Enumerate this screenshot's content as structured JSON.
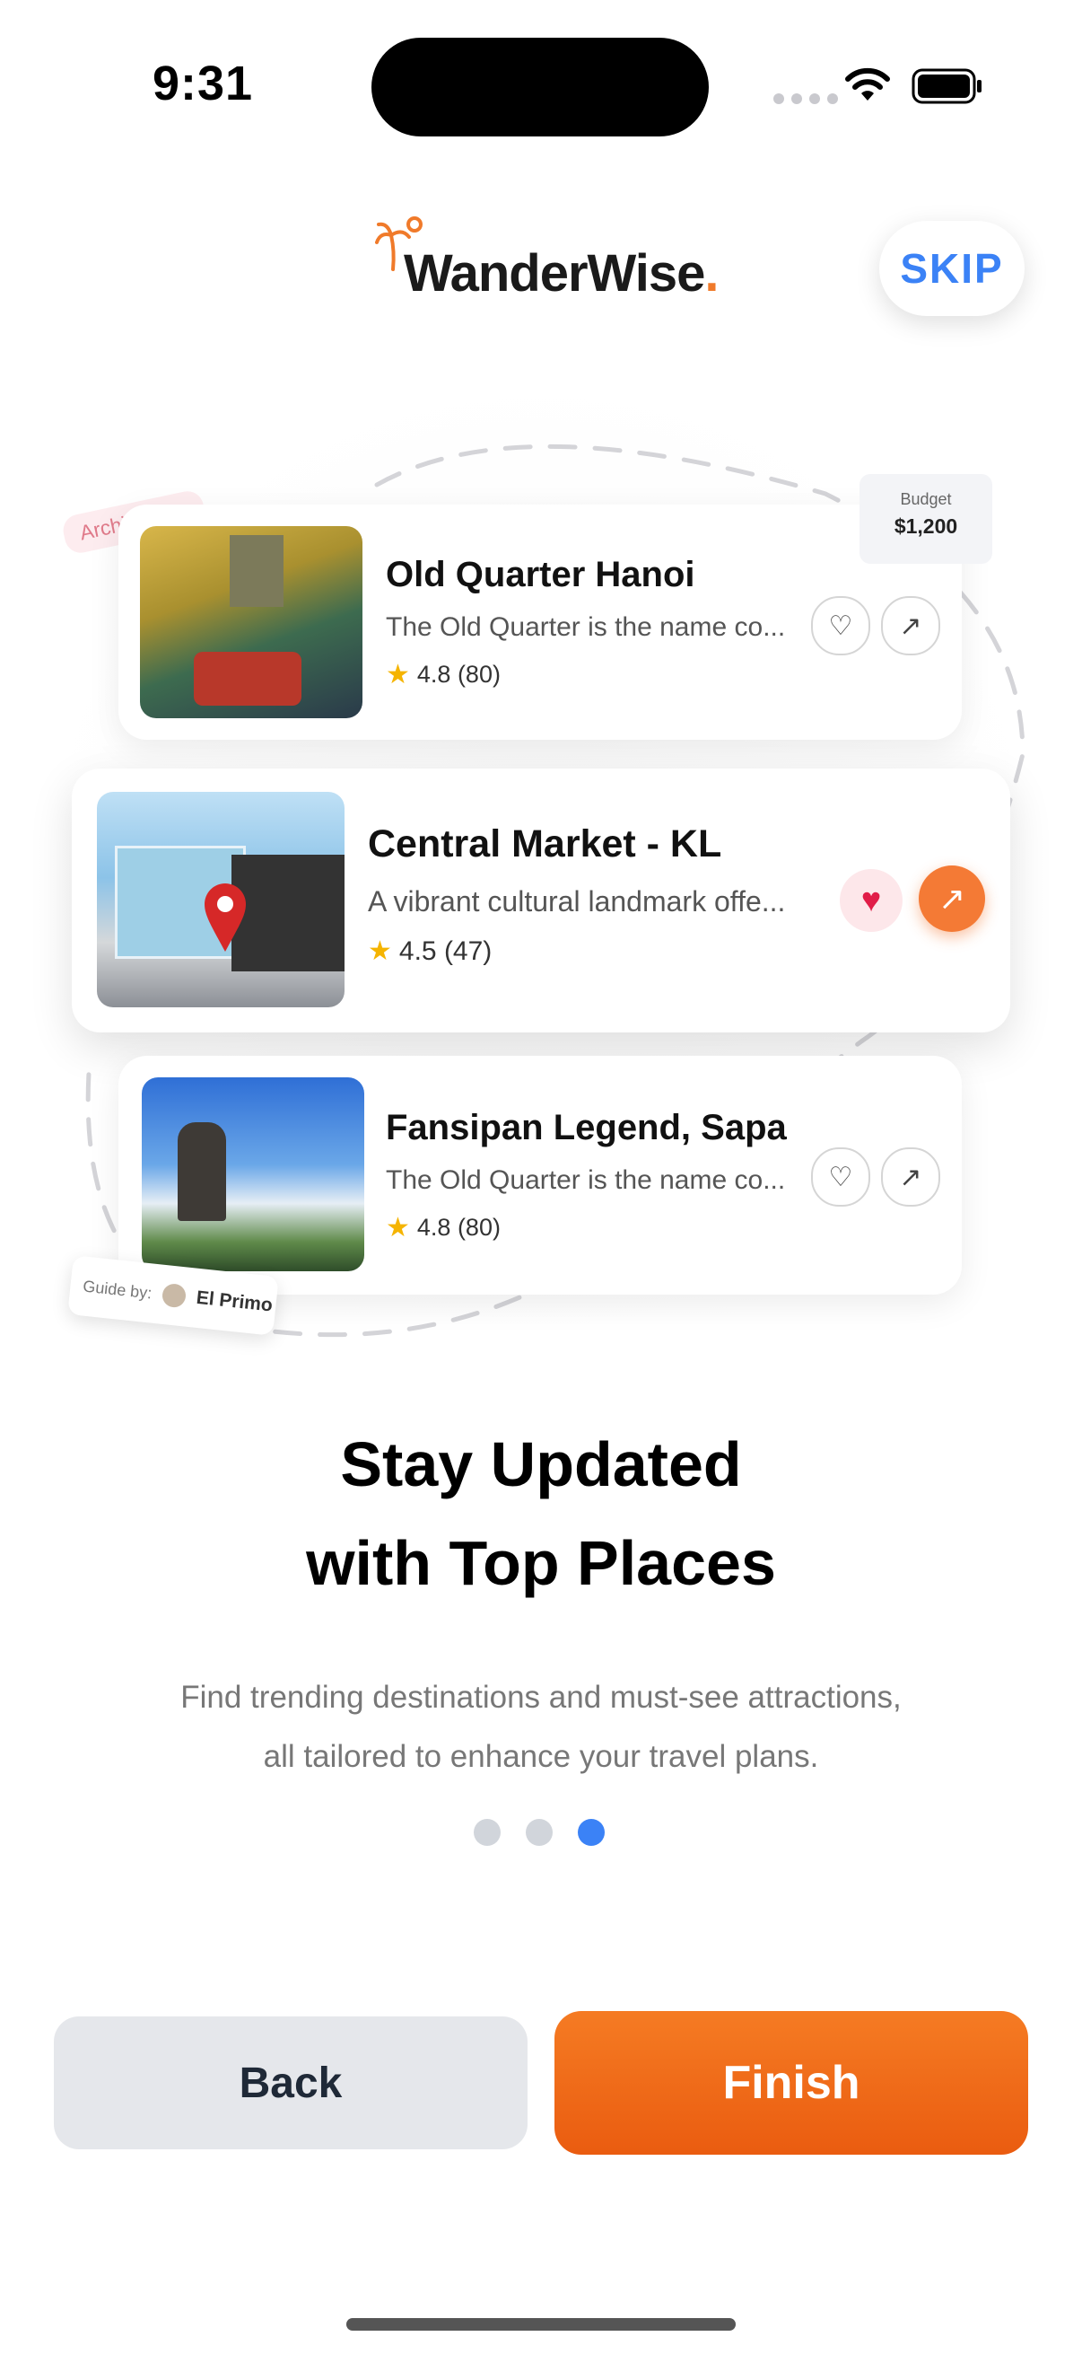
{
  "status_bar": {
    "time": "9:31"
  },
  "header": {
    "logo_text": "WanderWise",
    "logo_dot": ".",
    "skip_label": "SKIP"
  },
  "illustration": {
    "tag": "Architecture",
    "budget": {
      "label": "Budget",
      "value": "$1,200"
    },
    "guide": {
      "label": "Guide by:",
      "name": "El Primo"
    },
    "cards": [
      {
        "title": "Old Quarter Hanoi",
        "description": "The Old Quarter is the name co...",
        "rating": "4.8 (80)",
        "favorited": false
      },
      {
        "title": "Central Market - KL",
        "description": "A vibrant cultural landmark offe...",
        "rating": "4.5 (47)",
        "favorited": true
      },
      {
        "title": "Fansipan Legend, Sapa",
        "description": "The Old Quarter is the name co...",
        "rating": "4.8 (80)",
        "favorited": false
      }
    ]
  },
  "content": {
    "headline_line1": "Stay Updated",
    "headline_line2": "with Top Places",
    "sub_line1": "Find trending destinations and must-see attractions,",
    "sub_line2": "all tailored to enhance your travel plans."
  },
  "pagination": {
    "total": 3,
    "active_index": 2
  },
  "actions": {
    "back_label": "Back",
    "finish_label": "Finish"
  },
  "colors": {
    "accent_orange": "#f47a35",
    "accent_blue": "#3b82f6"
  },
  "icons": [
    "palm-tree-icon",
    "heart-icon",
    "arrow-up-right-icon",
    "star-icon",
    "wifi-icon",
    "battery-icon",
    "map-pin-icon"
  ]
}
